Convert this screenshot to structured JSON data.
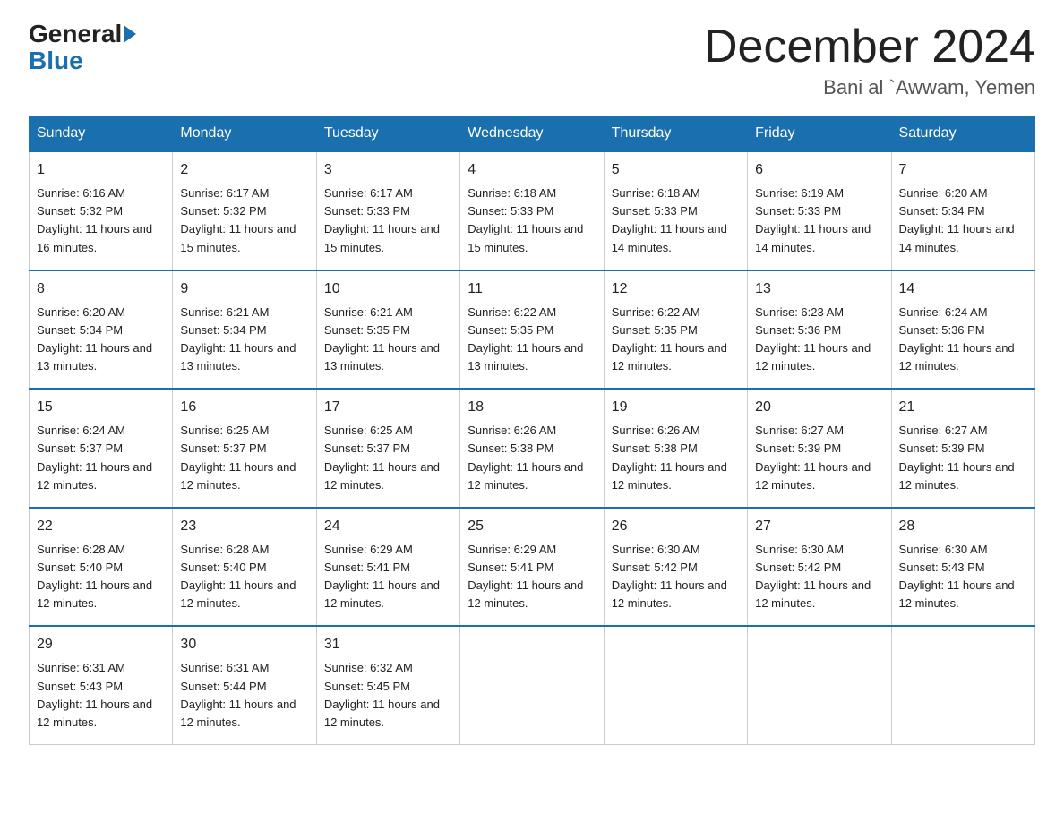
{
  "header": {
    "logo_general": "General",
    "logo_blue": "Blue",
    "month_title": "December 2024",
    "location": "Bani al `Awwam, Yemen"
  },
  "weekdays": [
    "Sunday",
    "Monday",
    "Tuesday",
    "Wednesday",
    "Thursday",
    "Friday",
    "Saturday"
  ],
  "weeks": [
    [
      {
        "day": "1",
        "sunrise": "6:16 AM",
        "sunset": "5:32 PM",
        "daylight": "11 hours and 16 minutes."
      },
      {
        "day": "2",
        "sunrise": "6:17 AM",
        "sunset": "5:32 PM",
        "daylight": "11 hours and 15 minutes."
      },
      {
        "day": "3",
        "sunrise": "6:17 AM",
        "sunset": "5:33 PM",
        "daylight": "11 hours and 15 minutes."
      },
      {
        "day": "4",
        "sunrise": "6:18 AM",
        "sunset": "5:33 PM",
        "daylight": "11 hours and 15 minutes."
      },
      {
        "day": "5",
        "sunrise": "6:18 AM",
        "sunset": "5:33 PM",
        "daylight": "11 hours and 14 minutes."
      },
      {
        "day": "6",
        "sunrise": "6:19 AM",
        "sunset": "5:33 PM",
        "daylight": "11 hours and 14 minutes."
      },
      {
        "day": "7",
        "sunrise": "6:20 AM",
        "sunset": "5:34 PM",
        "daylight": "11 hours and 14 minutes."
      }
    ],
    [
      {
        "day": "8",
        "sunrise": "6:20 AM",
        "sunset": "5:34 PM",
        "daylight": "11 hours and 13 minutes."
      },
      {
        "day": "9",
        "sunrise": "6:21 AM",
        "sunset": "5:34 PM",
        "daylight": "11 hours and 13 minutes."
      },
      {
        "day": "10",
        "sunrise": "6:21 AM",
        "sunset": "5:35 PM",
        "daylight": "11 hours and 13 minutes."
      },
      {
        "day": "11",
        "sunrise": "6:22 AM",
        "sunset": "5:35 PM",
        "daylight": "11 hours and 13 minutes."
      },
      {
        "day": "12",
        "sunrise": "6:22 AM",
        "sunset": "5:35 PM",
        "daylight": "11 hours and 12 minutes."
      },
      {
        "day": "13",
        "sunrise": "6:23 AM",
        "sunset": "5:36 PM",
        "daylight": "11 hours and 12 minutes."
      },
      {
        "day": "14",
        "sunrise": "6:24 AM",
        "sunset": "5:36 PM",
        "daylight": "11 hours and 12 minutes."
      }
    ],
    [
      {
        "day": "15",
        "sunrise": "6:24 AM",
        "sunset": "5:37 PM",
        "daylight": "11 hours and 12 minutes."
      },
      {
        "day": "16",
        "sunrise": "6:25 AM",
        "sunset": "5:37 PM",
        "daylight": "11 hours and 12 minutes."
      },
      {
        "day": "17",
        "sunrise": "6:25 AM",
        "sunset": "5:37 PM",
        "daylight": "11 hours and 12 minutes."
      },
      {
        "day": "18",
        "sunrise": "6:26 AM",
        "sunset": "5:38 PM",
        "daylight": "11 hours and 12 minutes."
      },
      {
        "day": "19",
        "sunrise": "6:26 AM",
        "sunset": "5:38 PM",
        "daylight": "11 hours and 12 minutes."
      },
      {
        "day": "20",
        "sunrise": "6:27 AM",
        "sunset": "5:39 PM",
        "daylight": "11 hours and 12 minutes."
      },
      {
        "day": "21",
        "sunrise": "6:27 AM",
        "sunset": "5:39 PM",
        "daylight": "11 hours and 12 minutes."
      }
    ],
    [
      {
        "day": "22",
        "sunrise": "6:28 AM",
        "sunset": "5:40 PM",
        "daylight": "11 hours and 12 minutes."
      },
      {
        "day": "23",
        "sunrise": "6:28 AM",
        "sunset": "5:40 PM",
        "daylight": "11 hours and 12 minutes."
      },
      {
        "day": "24",
        "sunrise": "6:29 AM",
        "sunset": "5:41 PM",
        "daylight": "11 hours and 12 minutes."
      },
      {
        "day": "25",
        "sunrise": "6:29 AM",
        "sunset": "5:41 PM",
        "daylight": "11 hours and 12 minutes."
      },
      {
        "day": "26",
        "sunrise": "6:30 AM",
        "sunset": "5:42 PM",
        "daylight": "11 hours and 12 minutes."
      },
      {
        "day": "27",
        "sunrise": "6:30 AM",
        "sunset": "5:42 PM",
        "daylight": "11 hours and 12 minutes."
      },
      {
        "day": "28",
        "sunrise": "6:30 AM",
        "sunset": "5:43 PM",
        "daylight": "11 hours and 12 minutes."
      }
    ],
    [
      {
        "day": "29",
        "sunrise": "6:31 AM",
        "sunset": "5:43 PM",
        "daylight": "11 hours and 12 minutes."
      },
      {
        "day": "30",
        "sunrise": "6:31 AM",
        "sunset": "5:44 PM",
        "daylight": "11 hours and 12 minutes."
      },
      {
        "day": "31",
        "sunrise": "6:32 AM",
        "sunset": "5:45 PM",
        "daylight": "11 hours and 12 minutes."
      },
      null,
      null,
      null,
      null
    ]
  ]
}
